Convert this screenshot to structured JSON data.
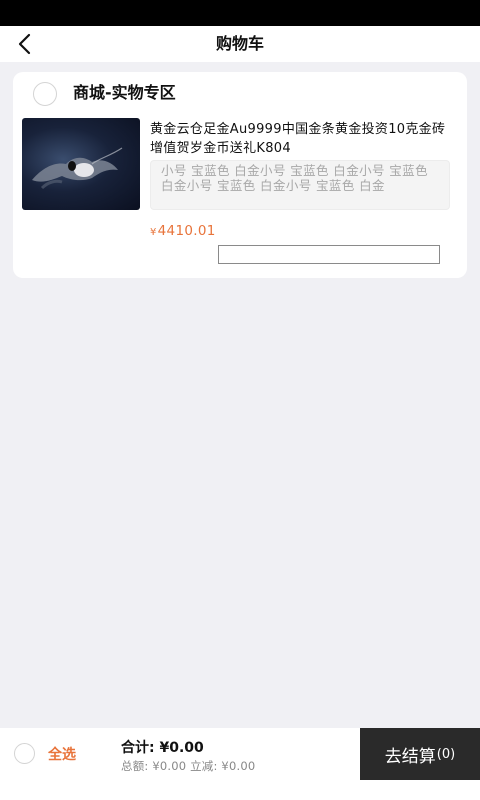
{
  "nav": {
    "title": "购物车",
    "back_icon": "chevron-left-icon"
  },
  "cart": {
    "shop_name": "商城-实物专区",
    "items": [
      {
        "title": "黄金云仓足金Au9999中国金条黄金投资10克金砖增值贺岁金币送礼K804",
        "specs": "小号 宝蓝色 白金小号 宝蓝色 白金小号 宝蓝色 白金小号 宝蓝色 白金小号 宝蓝色 白金",
        "currency": "¥",
        "price": "4410.01"
      }
    ]
  },
  "footer": {
    "select_all": "全选",
    "total_label": "合计:",
    "total_value": "¥0.00",
    "summary": "总额: ¥0.00 立减: ¥0.00",
    "checkout_label": "去结算",
    "checkout_count": "(0)"
  },
  "colors": {
    "accent": "#e8743b",
    "checkout_bg": "#2a2a2a",
    "page_bg": "#f0f0f4"
  }
}
